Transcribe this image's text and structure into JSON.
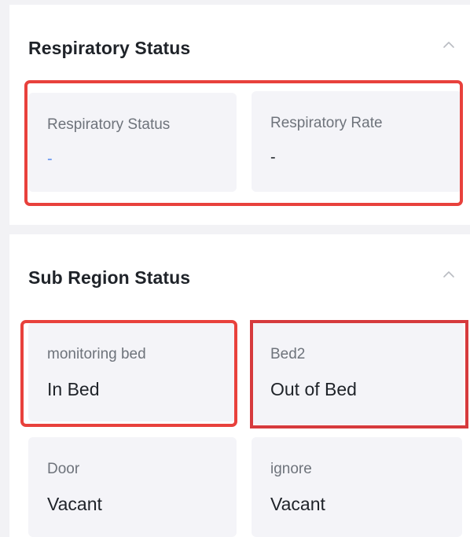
{
  "respiratory_panel": {
    "title": "Respiratory Status",
    "collapse_icon": "chevron-up-icon",
    "cards": [
      {
        "label": "Respiratory Status",
        "value": "-"
      },
      {
        "label": "Respiratory Rate",
        "value": "-"
      }
    ]
  },
  "sub_region_panel": {
    "title": "Sub Region Status",
    "collapse_icon": "chevron-up-icon",
    "cards": [
      {
        "label": "monitoring bed",
        "value": "In Bed"
      },
      {
        "label": "Bed2",
        "value": "Out of Bed"
      },
      {
        "label": "Door",
        "value": "Vacant"
      },
      {
        "label": "ignore",
        "value": "Vacant"
      }
    ]
  },
  "colors": {
    "highlight": "#e8413c",
    "card_background": "#f4f4f8",
    "status_dash_blue": "#5b8def"
  }
}
